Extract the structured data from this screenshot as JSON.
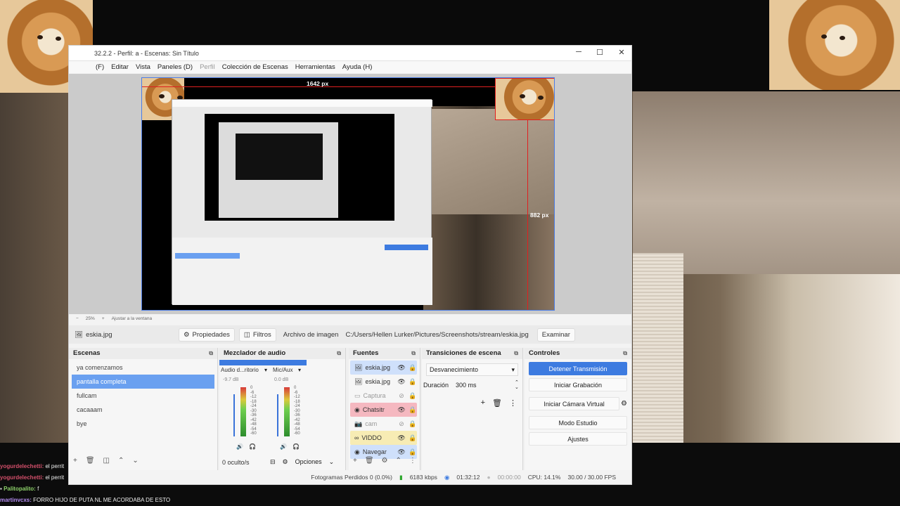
{
  "window": {
    "title": "32.2.2 - Perfil: a - Escenas: Sin Título",
    "minimize": "─",
    "maximize": "☐",
    "close": "✕"
  },
  "menu": [
    {
      "label": "(F)",
      "dim": false
    },
    {
      "label": "Editar",
      "dim": false
    },
    {
      "label": "Vista",
      "dim": false
    },
    {
      "label": "Paneles (D)",
      "dim": false
    },
    {
      "label": "Perfil",
      "dim": true
    },
    {
      "label": "Colección de Escenas",
      "dim": false
    },
    {
      "label": "Herramientas",
      "dim": false
    },
    {
      "label": "Ayuda (H)",
      "dim": false
    }
  ],
  "preview": {
    "width_label": "1642 px",
    "height_label": "882 px",
    "zoom": "25%",
    "fit": "Ajustar a la ventana"
  },
  "source_toolbar": {
    "source_name": "eskia.jpg",
    "properties": "Propiedades",
    "filters": "Filtros",
    "image_file_label": "Archivo de imagen",
    "image_path": "C:/Users/Hellen Lurker/Pictures/Screenshots/stream/eskia.jpg",
    "browse": "Examinar"
  },
  "scenes": {
    "title": "Escenas",
    "items": [
      {
        "label": "ya comenzamos",
        "selected": false
      },
      {
        "label": "pantalla completa",
        "selected": true
      },
      {
        "label": "fullcam",
        "selected": false
      },
      {
        "label": "cacaaam",
        "selected": false
      },
      {
        "label": "bye",
        "selected": false
      }
    ]
  },
  "mixer": {
    "title": "Mezclador de audio",
    "channels": [
      {
        "name": "Audio d...ritorio",
        "db": "-9.7 dB",
        "level": 0.45
      },
      {
        "name": "Mic/Aux",
        "db": "0.0 dB",
        "level": 0.55
      }
    ],
    "scale": [
      "0",
      "-6",
      "-12",
      "-18",
      "-24",
      "-30",
      "-36",
      "-42",
      "-48",
      "-54",
      "-60"
    ],
    "hidden": "0 oculto/s",
    "options": "Opciones"
  },
  "sources": {
    "title": "Fuentes",
    "items": [
      {
        "label": "eskia.jpg",
        "icon": "🖼",
        "bg": "#cfe0fb",
        "dim": false
      },
      {
        "label": "eskia.jpg",
        "icon": "🖼",
        "bg": "#f6f6f6",
        "dim": false
      },
      {
        "label": "Captura",
        "icon": "▭",
        "bg": "#f6f6f6",
        "dim": true
      },
      {
        "label": "Chatsitr",
        "icon": "◉",
        "bg": "#f5b8c0",
        "dim": false
      },
      {
        "label": "cam",
        "icon": "📷",
        "bg": "#f6f6f6",
        "dim": true
      },
      {
        "label": "VIDDO",
        "icon": "∞",
        "bg": "#f7ecb4",
        "dim": false
      },
      {
        "label": "Navegar",
        "icon": "◉",
        "bg": "#cfe0fb",
        "dim": false
      }
    ]
  },
  "transitions": {
    "title": "Transiciones de escena",
    "type": "Desvanecimiento",
    "duration_label": "Duración",
    "duration_value": "300 ms"
  },
  "controls": {
    "title": "Controles",
    "buttons": [
      "Detener Transmisión",
      "Iniciar Grabación",
      "Iniciar Cámara Virtual",
      "Modo Estudio",
      "Ajustes"
    ]
  },
  "status": {
    "dropped": "Fotogramas Perdidos 0 (0.0%)",
    "bitrate": "6183 kbps",
    "stream_time": "01:32:12",
    "rec_time": "00:00:00",
    "cpu": "CPU: 14.1%",
    "fps": "30.00 / 30.00 FPS"
  },
  "chat": [
    {
      "user": "yogurdelechetti:",
      "text": "el perrit"
    },
    {
      "user": "yogurdelechetti:",
      "text": "el perrit"
    },
    {
      "user": "Palitopalito:",
      "text": "f"
    },
    {
      "user": "martinvcxs:",
      "text": "FORRO HIJO DE PUTA NL ME ACORDABA DE ESTO"
    }
  ],
  "colors": {
    "accent": "#3d7be0",
    "selection": "#6aa0f0",
    "guide": "#e02020"
  }
}
